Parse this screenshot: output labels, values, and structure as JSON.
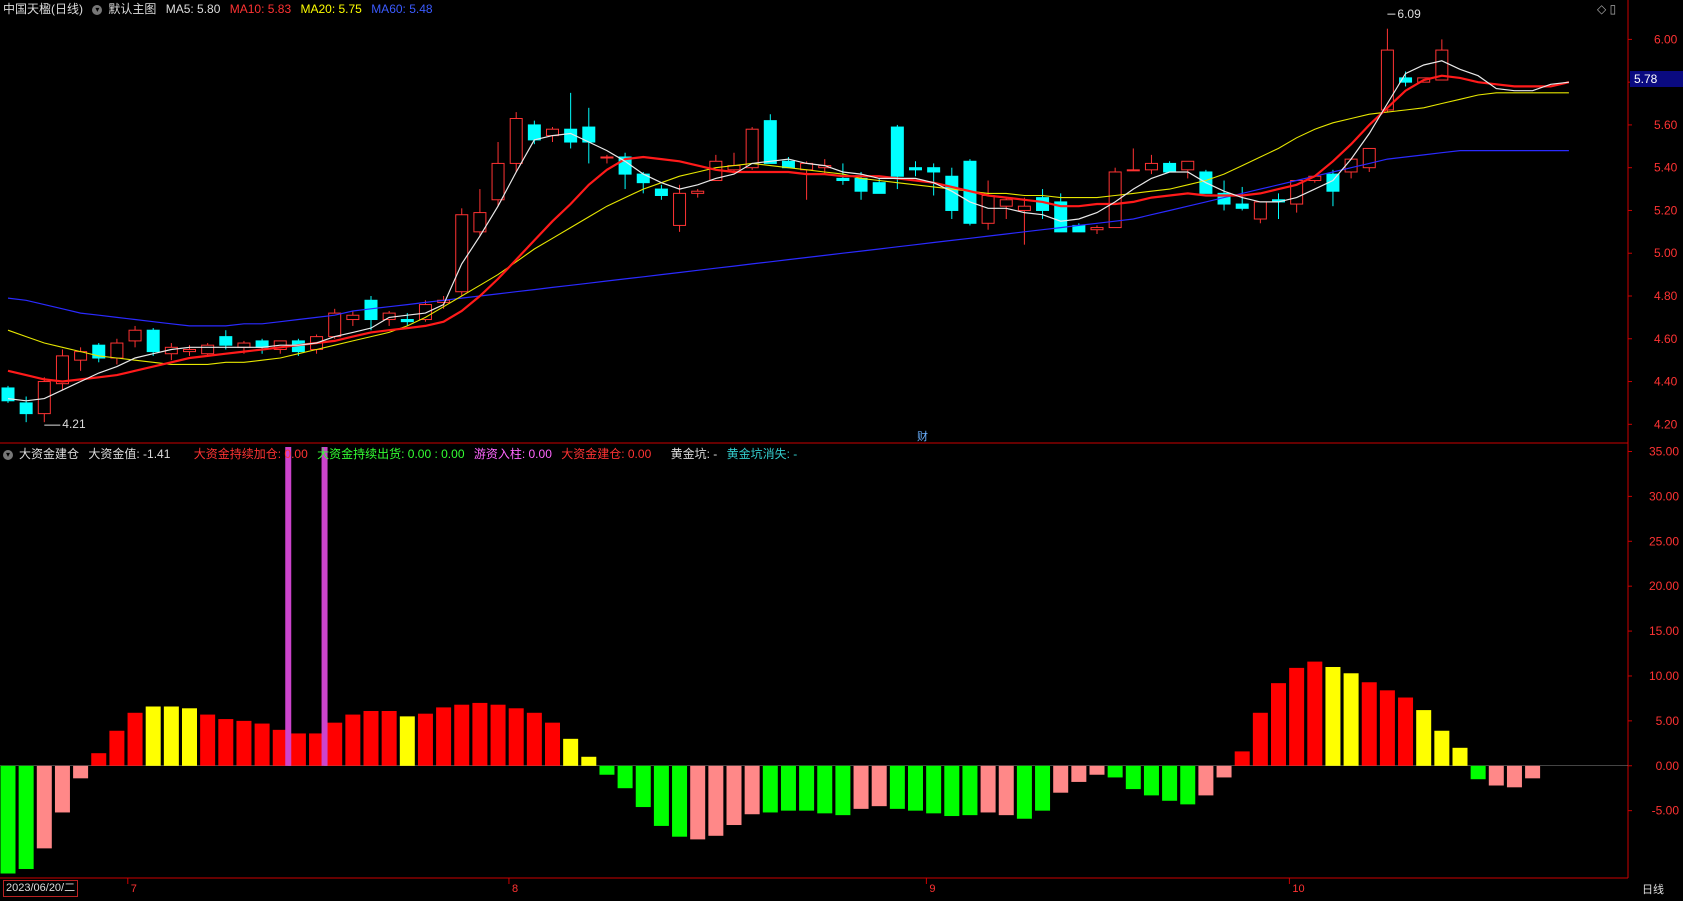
{
  "header": {
    "symbol": "中国天楹(日线)",
    "template": "默认主图",
    "ma5": "MA5: 5.80",
    "ma10": "MA10: 5.83",
    "ma20": "MA20: 5.75",
    "ma60": "MA60: 5.48"
  },
  "indicator_header": {
    "name": "大资金建仓",
    "value": "大资金值: -1.41",
    "f1": "大资金持续加仓: 0.00",
    "f2": "大资金持续出货: 0.00 : 0.00",
    "f3": "游资入柱: 0.00",
    "f4": "大资金建仓: 0.00",
    "f5": "黄金坑: -",
    "f6": "黄金坑消失: -"
  },
  "price_tag": "5.78",
  "date_label": "2023/06/20/二",
  "period_label": "日线",
  "finance_marker": "财",
  "colors": {
    "up": "#ff3333",
    "down": "#00ffff",
    "ma5": "#e8e8e8",
    "ma10": "#ff1a1a",
    "ma20": "#e6e600",
    "ma60": "#2a2aff",
    "axis": "#cc0000",
    "hist_red": "#ff0000",
    "hist_yellow": "#ffff00",
    "hist_green": "#00ff00",
    "hist_pink": "#ff8888",
    "hist_magenta": "#cc44cc"
  },
  "chart_data": [
    {
      "type": "candlestick",
      "ylim": [
        4.15,
        6.1
      ],
      "yticks": [
        "6.00",
        "5.80",
        "5.60",
        "5.40",
        "5.20",
        "5.00",
        "4.80",
        "4.60",
        "4.40",
        "4.20"
      ],
      "month_labels": [
        {
          "label": "7",
          "index": 7
        },
        {
          "label": "8",
          "index": 28
        },
        {
          "label": "9",
          "index": 51
        },
        {
          "label": "10",
          "index": 71
        }
      ],
      "annotations": [
        {
          "text": "4.21",
          "index": 2,
          "value": 4.21
        },
        {
          "text": "6.09",
          "index": 76,
          "value": 6.09
        }
      ],
      "ohlc": [
        [
          4.37,
          4.38,
          4.3,
          4.31
        ],
        [
          4.3,
          4.33,
          4.21,
          4.25
        ],
        [
          4.25,
          4.42,
          4.21,
          4.4
        ],
        [
          4.39,
          4.55,
          4.36,
          4.52
        ],
        [
          4.5,
          4.56,
          4.45,
          4.54
        ],
        [
          4.57,
          4.58,
          4.49,
          4.51
        ],
        [
          4.51,
          4.6,
          4.48,
          4.58
        ],
        [
          4.59,
          4.66,
          4.56,
          4.64
        ],
        [
          4.64,
          4.65,
          4.52,
          4.54
        ],
        [
          4.53,
          4.58,
          4.5,
          4.56
        ],
        [
          4.54,
          4.57,
          4.52,
          4.55
        ],
        [
          4.53,
          4.58,
          4.52,
          4.57
        ],
        [
          4.61,
          4.64,
          4.55,
          4.57
        ],
        [
          4.56,
          4.59,
          4.53,
          4.58
        ],
        [
          4.59,
          4.6,
          4.53,
          4.56
        ],
        [
          4.55,
          4.59,
          4.53,
          4.59
        ],
        [
          4.59,
          4.6,
          4.52,
          4.54
        ],
        [
          4.55,
          4.62,
          4.53,
          4.61
        ],
        [
          4.61,
          4.74,
          4.6,
          4.72
        ],
        [
          4.69,
          4.73,
          4.66,
          4.71
        ],
        [
          4.78,
          4.8,
          4.64,
          4.69
        ],
        [
          4.69,
          4.73,
          4.66,
          4.72
        ],
        [
          4.69,
          4.72,
          4.66,
          4.68
        ],
        [
          4.69,
          4.78,
          4.68,
          4.76
        ],
        [
          4.77,
          4.8,
          4.74,
          4.78
        ],
        [
          4.82,
          5.21,
          4.8,
          5.18
        ],
        [
          5.1,
          5.3,
          5.08,
          5.19
        ],
        [
          5.25,
          5.52,
          5.22,
          5.42
        ],
        [
          5.42,
          5.66,
          5.38,
          5.63
        ],
        [
          5.6,
          5.62,
          5.51,
          5.53
        ],
        [
          5.55,
          5.59,
          5.52,
          5.58
        ],
        [
          5.58,
          5.75,
          5.49,
          5.52
        ],
        [
          5.59,
          5.68,
          5.42,
          5.52
        ],
        [
          5.45,
          5.46,
          5.42,
          5.45
        ],
        [
          5.45,
          5.47,
          5.3,
          5.37
        ],
        [
          5.37,
          5.38,
          5.28,
          5.33
        ],
        [
          5.3,
          5.32,
          5.25,
          5.27
        ],
        [
          5.13,
          5.32,
          5.1,
          5.28
        ],
        [
          5.28,
          5.3,
          5.26,
          5.29
        ],
        [
          5.34,
          5.46,
          5.34,
          5.43
        ],
        [
          5.39,
          5.47,
          5.38,
          5.41
        ],
        [
          5.4,
          5.59,
          5.39,
          5.58
        ],
        [
          5.62,
          5.65,
          5.42,
          5.42
        ],
        [
          5.43,
          5.45,
          5.4,
          5.4
        ],
        [
          5.39,
          5.43,
          5.25,
          5.42
        ],
        [
          5.4,
          5.44,
          5.37,
          5.41
        ],
        [
          5.35,
          5.42,
          5.32,
          5.34
        ],
        [
          5.35,
          5.38,
          5.25,
          5.29
        ],
        [
          5.33,
          5.35,
          5.28,
          5.28
        ],
        [
          5.59,
          5.6,
          5.3,
          5.36
        ],
        [
          5.4,
          5.43,
          5.36,
          5.39
        ],
        [
          5.4,
          5.42,
          5.27,
          5.38
        ],
        [
          5.36,
          5.4,
          5.16,
          5.2
        ],
        [
          5.43,
          5.44,
          5.13,
          5.14
        ],
        [
          5.14,
          5.34,
          5.11,
          5.27
        ],
        [
          5.22,
          5.26,
          5.16,
          5.25
        ],
        [
          5.2,
          5.26,
          5.04,
          5.22
        ],
        [
          5.26,
          5.3,
          5.16,
          5.2
        ],
        [
          5.24,
          5.28,
          5.1,
          5.1
        ],
        [
          5.13,
          5.14,
          5.1,
          5.1
        ],
        [
          5.11,
          5.13,
          5.09,
          5.12
        ],
        [
          5.12,
          5.4,
          5.12,
          5.38
        ],
        [
          5.39,
          5.49,
          5.39,
          5.39
        ],
        [
          5.39,
          5.46,
          5.37,
          5.42
        ],
        [
          5.42,
          5.43,
          5.38,
          5.38
        ],
        [
          5.39,
          5.43,
          5.35,
          5.43
        ],
        [
          5.38,
          5.39,
          5.28,
          5.28
        ],
        [
          5.28,
          5.34,
          5.2,
          5.23
        ],
        [
          5.23,
          5.31,
          5.2,
          5.21
        ],
        [
          5.16,
          5.21,
          5.14,
          5.24
        ],
        [
          5.25,
          5.28,
          5.16,
          5.24
        ],
        [
          5.23,
          5.32,
          5.19,
          5.34
        ],
        [
          5.34,
          5.36,
          5.33,
          5.36
        ],
        [
          5.37,
          5.39,
          5.22,
          5.29
        ],
        [
          5.38,
          5.43,
          5.35,
          5.44
        ],
        [
          5.4,
          5.46,
          5.38,
          5.49
        ],
        [
          5.67,
          6.05,
          5.66,
          5.95
        ],
        [
          5.82,
          5.85,
          5.78,
          5.8
        ],
        [
          5.8,
          5.8,
          5.8,
          5.82
        ],
        [
          5.81,
          6.0,
          5.81,
          5.95
        ]
      ],
      "ma5": [
        4.32,
        4.31,
        4.32,
        4.36,
        4.4,
        4.44,
        4.47,
        4.51,
        4.53,
        4.55,
        4.56,
        4.56,
        4.56,
        4.56,
        4.56,
        4.57,
        4.57,
        4.58,
        4.61,
        4.63,
        4.65,
        4.7,
        4.71,
        4.72,
        4.76,
        4.95,
        5.08,
        5.22,
        5.38,
        5.53,
        5.55,
        5.56,
        5.52,
        5.48,
        5.43,
        5.37,
        5.33,
        5.3,
        5.32,
        5.35,
        5.37,
        5.42,
        5.43,
        5.44,
        5.42,
        5.41,
        5.38,
        5.37,
        5.35,
        5.35,
        5.35,
        5.33,
        5.29,
        5.24,
        5.21,
        5.21,
        5.19,
        5.18,
        5.15,
        5.16,
        5.19,
        5.24,
        5.3,
        5.35,
        5.38,
        5.38,
        5.33,
        5.29,
        5.26,
        5.24,
        5.24,
        5.26,
        5.3,
        5.34,
        5.44,
        5.56,
        5.7,
        5.84,
        5.88,
        5.9,
        5.86,
        5.83,
        5.77,
        5.76,
        5.76,
        5.79,
        5.8
      ],
      "ma10": [
        4.45,
        4.43,
        4.41,
        4.4,
        4.41,
        4.42,
        4.43,
        4.45,
        4.47,
        4.49,
        4.51,
        4.52,
        4.53,
        4.54,
        4.55,
        4.56,
        4.57,
        4.58,
        4.59,
        4.61,
        4.63,
        4.64,
        4.65,
        4.66,
        4.68,
        4.73,
        4.8,
        4.88,
        4.97,
        5.06,
        5.15,
        5.23,
        5.32,
        5.39,
        5.44,
        5.45,
        5.44,
        5.43,
        5.41,
        5.39,
        5.38,
        5.38,
        5.38,
        5.38,
        5.37,
        5.37,
        5.36,
        5.36,
        5.36,
        5.35,
        5.34,
        5.33,
        5.31,
        5.29,
        5.27,
        5.26,
        5.25,
        5.24,
        5.22,
        5.22,
        5.23,
        5.23,
        5.24,
        5.26,
        5.27,
        5.28,
        5.27,
        5.27,
        5.27,
        5.28,
        5.3,
        5.32,
        5.36,
        5.43,
        5.51,
        5.6,
        5.68,
        5.76,
        5.81,
        5.83,
        5.82,
        5.8,
        5.79,
        5.78,
        5.78,
        5.78,
        5.8
      ],
      "ma20": [
        4.64,
        4.61,
        4.58,
        4.56,
        4.54,
        4.52,
        4.51,
        4.5,
        4.49,
        4.48,
        4.48,
        4.48,
        4.49,
        4.49,
        4.5,
        4.51,
        4.53,
        4.55,
        4.57,
        4.59,
        4.61,
        4.63,
        4.66,
        4.7,
        4.75,
        4.8,
        4.85,
        4.9,
        4.96,
        5.02,
        5.07,
        5.12,
        5.17,
        5.22,
        5.26,
        5.3,
        5.33,
        5.36,
        5.38,
        5.4,
        5.41,
        5.42,
        5.41,
        5.4,
        5.39,
        5.38,
        5.37,
        5.35,
        5.34,
        5.33,
        5.32,
        5.31,
        5.3,
        5.29,
        5.28,
        5.28,
        5.27,
        5.27,
        5.26,
        5.26,
        5.26,
        5.27,
        5.28,
        5.29,
        5.3,
        5.32,
        5.34,
        5.37,
        5.41,
        5.45,
        5.49,
        5.54,
        5.58,
        5.61,
        5.63,
        5.65,
        5.66,
        5.67,
        5.68,
        5.7,
        5.72,
        5.74,
        5.75,
        5.75,
        5.75,
        5.75,
        5.75
      ],
      "ma60": [
        4.79,
        4.78,
        4.76,
        4.74,
        4.72,
        4.71,
        4.7,
        4.69,
        4.68,
        4.67,
        4.66,
        4.66,
        4.66,
        4.67,
        4.67,
        4.68,
        4.69,
        4.7,
        4.71,
        4.73,
        4.74,
        4.75,
        4.76,
        4.77,
        4.78,
        4.79,
        4.8,
        4.81,
        4.82,
        4.83,
        4.84,
        4.85,
        4.86,
        4.87,
        4.88,
        4.89,
        4.9,
        4.91,
        4.92,
        4.93,
        4.94,
        4.95,
        4.96,
        4.97,
        4.98,
        4.99,
        5.0,
        5.01,
        5.02,
        5.03,
        5.04,
        5.05,
        5.06,
        5.07,
        5.08,
        5.09,
        5.1,
        5.11,
        5.12,
        5.13,
        5.14,
        5.15,
        5.16,
        5.18,
        5.2,
        5.22,
        5.24,
        5.26,
        5.28,
        5.3,
        5.32,
        5.34,
        5.36,
        5.38,
        5.4,
        5.42,
        5.44,
        5.45,
        5.46,
        5.47,
        5.48,
        5.48,
        5.48,
        5.48,
        5.48,
        5.48,
        5.48
      ]
    },
    {
      "type": "bar",
      "ylim": [
        -12.5,
        35.5
      ],
      "yticks": [
        "35.00",
        "30.00",
        "25.00",
        "20.00",
        "15.00",
        "10.00",
        "5.00",
        "0.00",
        "-5.00"
      ],
      "values": [
        -12.0,
        -11.5,
        -9.2,
        -5.2,
        -1.4,
        1.4,
        3.9,
        5.9,
        6.6,
        6.6,
        6.4,
        5.7,
        5.2,
        5.0,
        4.7,
        4.0,
        3.6,
        3.6,
        4.8,
        5.7,
        6.1,
        6.1,
        5.5,
        5.8,
        6.5,
        6.8,
        7.0,
        6.8,
        6.4,
        5.9,
        4.8,
        3.0,
        1.0,
        -1.0,
        -2.5,
        -4.6,
        -6.7,
        -7.9,
        -8.2,
        -7.8,
        -6.6,
        -5.4,
        -5.2,
        -5.0,
        -5.0,
        -5.3,
        -5.5,
        -4.8,
        -4.5,
        -4.8,
        -5.0,
        -5.3,
        -5.6,
        -5.5,
        -5.2,
        -5.5,
        -5.9,
        -5.0,
        -3.0,
        -1.8,
        -1.0,
        -1.3,
        -2.6,
        -3.3,
        -3.9,
        -4.3,
        -3.3,
        -1.3,
        1.6,
        5.9,
        9.2,
        10.9,
        11.6,
        11.0,
        10.3,
        9.3,
        8.4,
        7.6,
        6.2,
        3.9,
        2.0,
        -1.5,
        -2.2,
        -2.4,
        -1.4
      ],
      "colors": [
        "g",
        "g",
        "p",
        "p",
        "p",
        "r",
        "r",
        "r",
        "y",
        "y",
        "y",
        "r",
        "r",
        "r",
        "r",
        "r",
        "r",
        "r",
        "r",
        "r",
        "r",
        "r",
        "y",
        "r",
        "r",
        "r",
        "r",
        "r",
        "r",
        "r",
        "r",
        "y",
        "y",
        "g",
        "g",
        "g",
        "g",
        "g",
        "p",
        "p",
        "p",
        "p",
        "g",
        "g",
        "g",
        "g",
        "g",
        "p",
        "p",
        "g",
        "g",
        "g",
        "g",
        "g",
        "p",
        "p",
        "g",
        "g",
        "p",
        "p",
        "p",
        "g",
        "g",
        "g",
        "g",
        "g",
        "p",
        "p",
        "r",
        "r",
        "r",
        "r",
        "r",
        "y",
        "y",
        "r",
        "r",
        "r",
        "y",
        "y",
        "y",
        "g",
        "p",
        "p",
        "p"
      ],
      "spikes": [
        {
          "index": 15,
          "value": 35.5
        },
        {
          "index": 17,
          "value": 35.5
        }
      ]
    }
  ]
}
